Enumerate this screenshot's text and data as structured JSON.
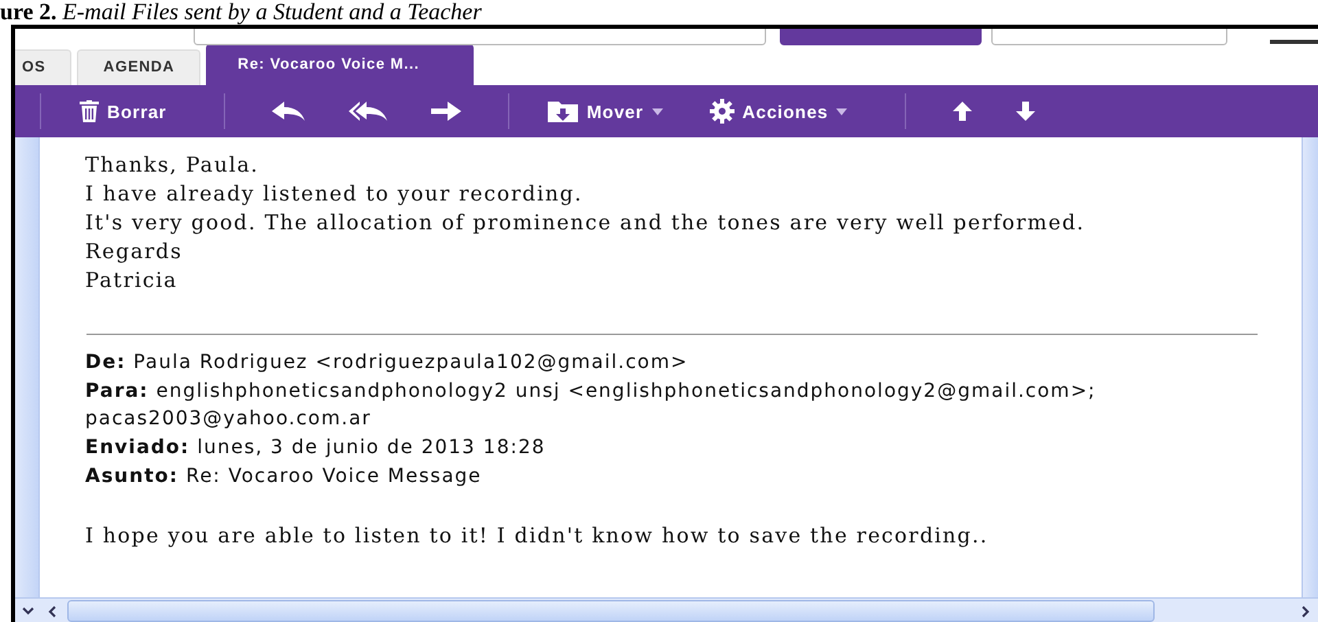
{
  "caption": "**ure 2.** *E-mail Files sent by a Student and a Teacher*",
  "tabs": [
    {
      "label": "OS",
      "selected": false
    },
    {
      "label": "AGENDA",
      "selected": false
    },
    {
      "label": "Re: Vocaroo Voice M...",
      "selected": true
    }
  ],
  "toolbar": [
    {
      "kind": "delete",
      "label": "Borrar"
    },
    {
      "kind": "reply"
    },
    {
      "kind": "reply-all"
    },
    {
      "kind": "forward"
    },
    {
      "kind": "move",
      "label": "Mover",
      "dropdown": true
    },
    {
      "kind": "actions",
      "label": "Acciones",
      "dropdown": true
    },
    {
      "kind": "up"
    },
    {
      "kind": "down"
    }
  ],
  "reply_lines": [
    "Thanks, Paula.",
    "I have already listened to your recording.",
    "It's very good. The allocation of prominence and the tones are very well performed.",
    "Regards",
    "Patricia"
  ],
  "headers": [
    {
      "label": "De:",
      "value": "Paula Rodriguez <rodriguezpaula102@gmail.com>"
    },
    {
      "label": "Para:",
      "value": "englishphoneticsandphonology2 unsj <englishphoneticsandphonology2@gmail.com>;",
      "continued": "pacas2003@yahoo.com.ar"
    },
    {
      "label": "Enviado:",
      "value": "lunes, 3 de junio de 2013 18:28"
    },
    {
      "label": "Asunto:",
      "value": "Re: Vocaroo Voice Message"
    }
  ],
  "original_lines": [
    "I hope you are able to listen to it! I didn't know how to save the recording.."
  ]
}
